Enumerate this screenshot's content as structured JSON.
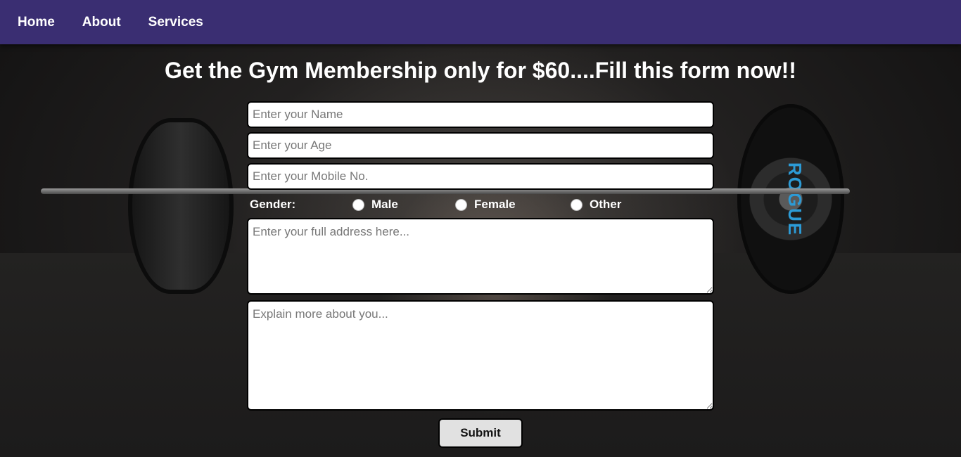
{
  "nav": {
    "items": [
      {
        "label": "Home"
      },
      {
        "label": "About"
      },
      {
        "label": "Services"
      }
    ]
  },
  "heading": "Get the Gym Membership only for $60....Fill this form now!!",
  "form": {
    "name": {
      "placeholder": "Enter your Name",
      "value": ""
    },
    "age": {
      "placeholder": "Enter your Age",
      "value": ""
    },
    "mobile": {
      "placeholder": "Enter your Mobile No.",
      "value": ""
    },
    "gender": {
      "label": "Gender:",
      "options": [
        {
          "label": "Male",
          "selected": false
        },
        {
          "label": "Female",
          "selected": false
        },
        {
          "label": "Other",
          "selected": false
        }
      ]
    },
    "address": {
      "placeholder": "Enter your full address here...",
      "value": ""
    },
    "about": {
      "placeholder": "Explain more about you...",
      "value": ""
    },
    "submit_label": "Submit"
  },
  "colors": {
    "navbar": "#3a2e72",
    "text": "#ffffff",
    "button": "#e1e1e1",
    "plate_accent": "#2c9bd6"
  }
}
